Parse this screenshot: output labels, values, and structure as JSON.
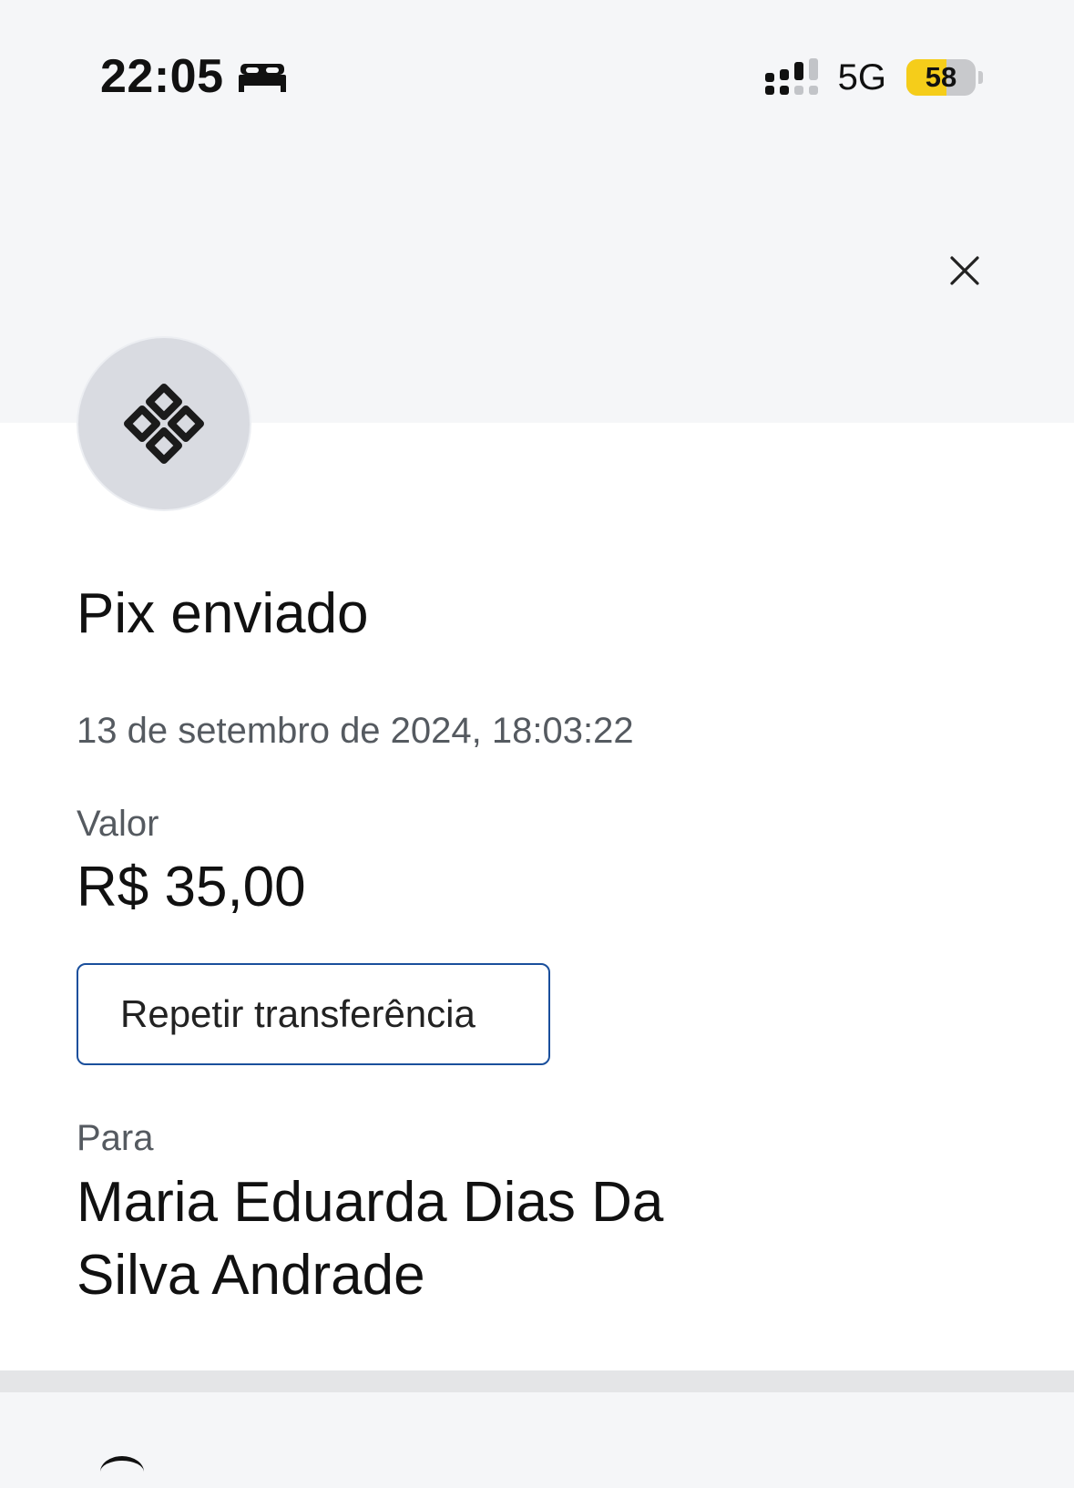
{
  "status_bar": {
    "time": "22:05",
    "focus_icon": "bed-icon",
    "signal_icon": "cellular-signal-icon",
    "network": "5G",
    "battery": "58",
    "battery_level_percent": 58,
    "battery_color": "#f5cd1a"
  },
  "header": {
    "close_icon": "close-icon"
  },
  "transaction": {
    "icon": "pix-icon",
    "title": "Pix enviado",
    "datetime": "13 de setembro de 2024, 18:03:22",
    "value_label": "Valor",
    "value": "R$ 35,00",
    "repeat_button_label": "Repetir transferência",
    "to_label": "Para",
    "recipient_name": "Maria Eduarda Dias Da Silva Andrade"
  },
  "colors": {
    "accent": "#1a4f9c",
    "background": "#f5f6f8",
    "card": "#ffffff",
    "avatar_bg": "#d9dbe1"
  }
}
